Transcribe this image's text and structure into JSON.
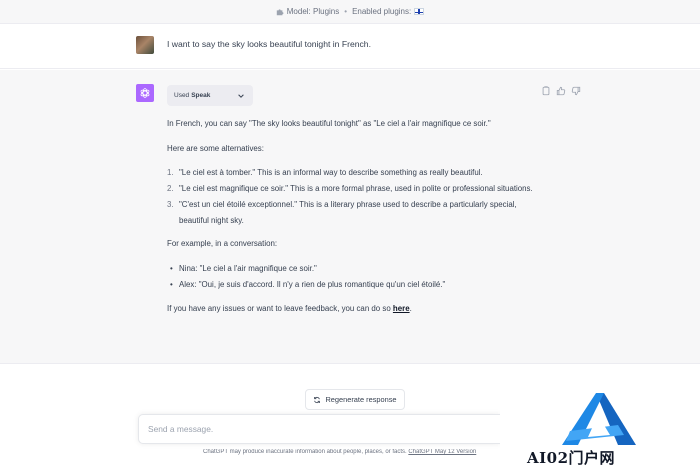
{
  "top_bar": {
    "model_label": "Model: Plugins",
    "separator": "•",
    "enabled_label": "Enabled plugins:"
  },
  "user_message": {
    "text": "I want to say the sky looks beautiful tonight in French."
  },
  "assistant": {
    "plugin_used_prefix": "Used",
    "plugin_name": "Speak",
    "intro": "In French, you can say \"The sky looks beautiful tonight\" as \"Le ciel a l'air magnifique ce soir.\"",
    "alternatives_heading": "Here are some alternatives:",
    "alternatives": [
      {
        "num": "1.",
        "text": "\"Le ciel est à tomber.\" This is an informal way to describe something as really beautiful."
      },
      {
        "num": "2.",
        "text": "\"Le ciel est magnifique ce soir.\" This is a more formal phrase, used in polite or professional situations."
      },
      {
        "num": "3.",
        "text": "\"C'est un ciel étoilé exceptionnel.\" This is a literary phrase used to describe a particularly special, beautiful night sky."
      }
    ],
    "example_heading": "For example, in a conversation:",
    "dialogue": [
      {
        "bullet": "•",
        "text": "Nina: \"Le ciel a l'air magnifique ce soir.\""
      },
      {
        "bullet": "•",
        "text": "Alex: \"Oui, je suis d'accord. Il n'y a rien de plus romantique qu'un ciel étoilé.\""
      }
    ],
    "feedback_text": "If you have any issues or want to leave feedback, you can do so",
    "feedback_link": "here",
    "feedback_end": "."
  },
  "controls": {
    "regenerate_label": "Regenerate response",
    "message_placeholder": "Send a message."
  },
  "footer": {
    "note": "ChatGPT may produce inaccurate information about people, places, or facts.",
    "version_link": "ChatGPT May 12 Version"
  },
  "watermark": {
    "text": "AI02门户网"
  },
  "colors": {
    "gpt_avatar": "#ab68ff",
    "assistant_bg": "#f7f7f8",
    "watermark_blue": "#1565c0"
  },
  "icons": [
    "puzzle-icon",
    "finland-flag-icon",
    "openai-logo-icon",
    "chevron-down-icon",
    "copy-icon",
    "thumbs-up-icon",
    "thumbs-down-icon",
    "refresh-icon"
  ]
}
